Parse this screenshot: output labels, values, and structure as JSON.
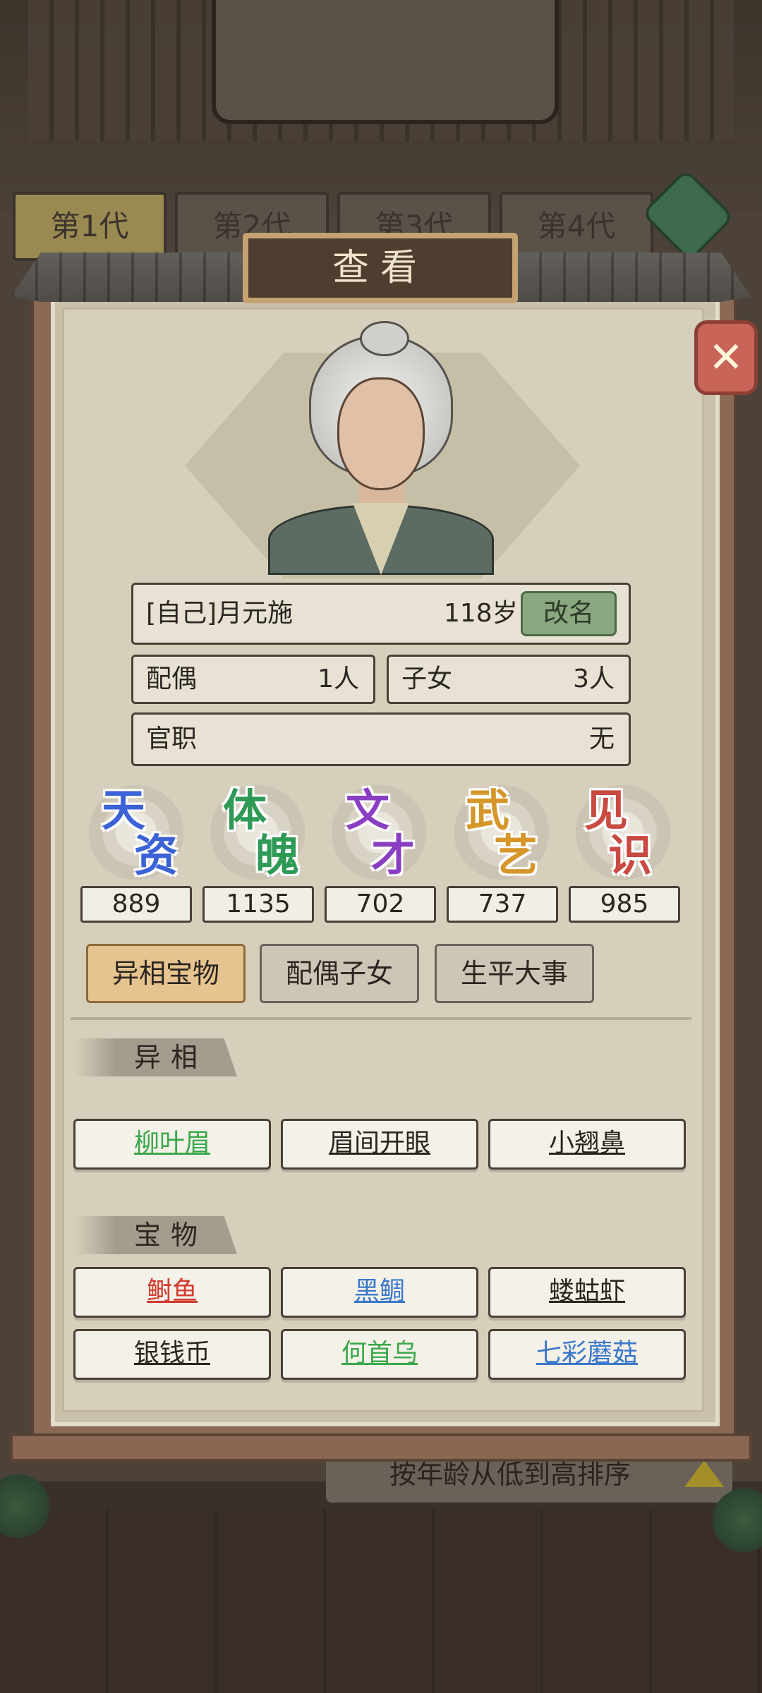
{
  "background": {
    "generation_tabs": [
      "第1代",
      "第2代",
      "第3代",
      "第4代"
    ],
    "sort_label": "按年龄从低到高排序"
  },
  "dialog": {
    "title": "查看",
    "close_icon": "close-icon"
  },
  "person": {
    "name": "[自己]月元施",
    "age": "118岁",
    "rename_label": "改名",
    "spouse_label": "配偶",
    "spouse_count": "1人",
    "children_label": "子女",
    "children_count": "3人",
    "office_label": "官职",
    "office_value": "无"
  },
  "stats": [
    {
      "chars": [
        "天",
        "资"
      ],
      "value": "889",
      "color": "#3b62d6"
    },
    {
      "chars": [
        "体",
        "魄"
      ],
      "value": "1135",
      "color": "#2f9a55"
    },
    {
      "chars": [
        "文",
        "才"
      ],
      "value": "702",
      "color": "#8a3fc2"
    },
    {
      "chars": [
        "武",
        "艺"
      ],
      "value": "737",
      "color": "#d6962a"
    },
    {
      "chars": [
        "见",
        "识"
      ],
      "value": "985",
      "color": "#c94a42"
    }
  ],
  "tabs": [
    {
      "label": "异相宝物",
      "active": true
    },
    {
      "label": "配偶子女",
      "active": false
    },
    {
      "label": "生平大事",
      "active": false
    }
  ],
  "sections": {
    "features_title": "异相",
    "treasures_title": "宝物"
  },
  "features": [
    {
      "label": "柳叶眉",
      "color": "#3aa84a"
    },
    {
      "label": "眉间开眼",
      "color": "#2b2621"
    },
    {
      "label": "小翘鼻",
      "color": "#2b2621"
    }
  ],
  "treasures": [
    {
      "label": "鲥鱼",
      "color": "#d23a2e"
    },
    {
      "label": "黑鲷",
      "color": "#3a78c9"
    },
    {
      "label": "蝼蛄虾",
      "color": "#2b2621"
    },
    {
      "label": "银钱币",
      "color": "#2b2621"
    },
    {
      "label": "何首乌",
      "color": "#3aa84a"
    },
    {
      "label": "七彩蘑菇",
      "color": "#3a78c9"
    }
  ]
}
